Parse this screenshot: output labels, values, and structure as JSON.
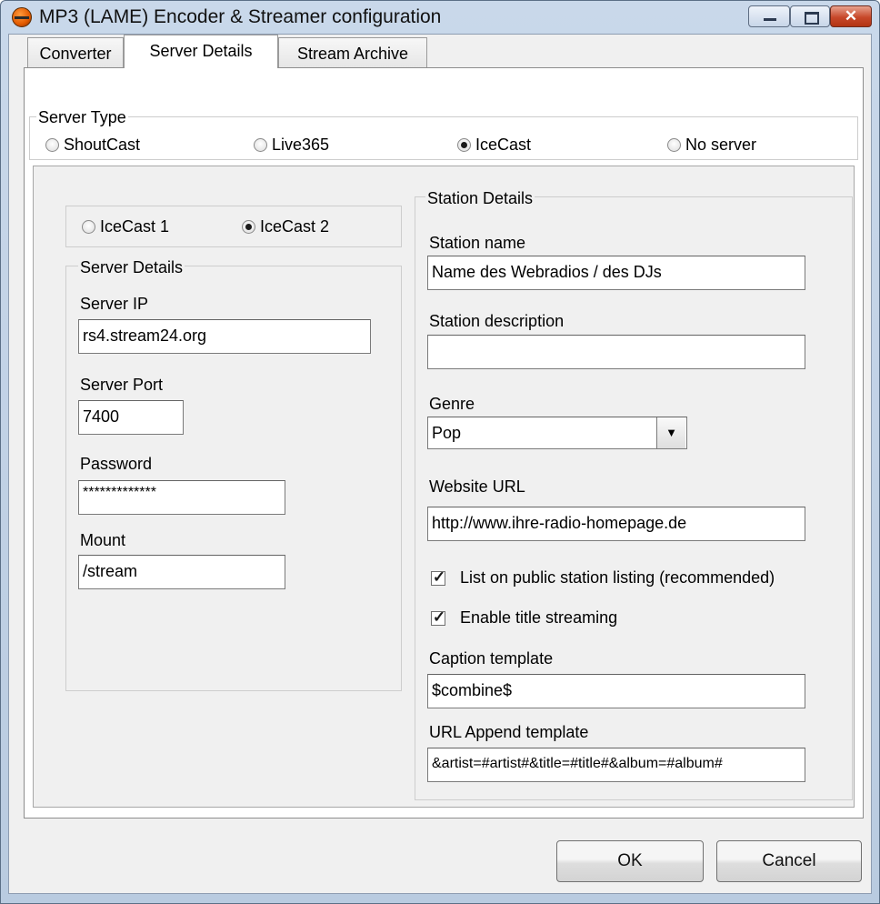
{
  "window": {
    "title": "MP3 (LAME) Encoder & Streamer configuration",
    "close_glyph": "✕"
  },
  "tabs": [
    {
      "label": "Converter",
      "selected": false
    },
    {
      "label": "Server Details",
      "selected": true
    },
    {
      "label": "Stream Archive",
      "selected": false
    }
  ],
  "server_type": {
    "label": "Server Type",
    "options": [
      {
        "label": "ShoutCast",
        "checked": false
      },
      {
        "label": "Live365",
        "checked": false
      },
      {
        "label": "IceCast",
        "checked": true
      },
      {
        "label": "No server",
        "checked": false
      }
    ]
  },
  "icecast_version": {
    "options": [
      {
        "label": "IceCast 1",
        "checked": false
      },
      {
        "label": "IceCast 2",
        "checked": true
      }
    ]
  },
  "server_details": {
    "label": "Server Details",
    "server_ip_label": "Server IP",
    "server_ip_value": "rs4.stream24.org",
    "server_port_label": "Server Port",
    "server_port_value": "7400",
    "password_label": "Password",
    "password_value": "*************",
    "mount_label": "Mount",
    "mount_value": "/stream"
  },
  "station_details": {
    "label": "Station Details",
    "name_label": "Station name",
    "name_value": "Name des Webradios / des DJs",
    "description_label": "Station description",
    "description_value": "",
    "genre_label": "Genre",
    "genre_value": "Pop",
    "website_label": "Website URL",
    "website_value": "http://www.ihre-radio-homepage.de",
    "list_public_label": "List on public station listing (recommended)",
    "list_public_checked": true,
    "title_streaming_label": "Enable title streaming",
    "title_streaming_checked": true,
    "caption_label": "Caption template",
    "caption_value": "$combine$",
    "url_append_label": "URL Append template",
    "url_append_value": "&artist=#artist#&title=#title#&album=#album#"
  },
  "buttons": {
    "ok": "OK",
    "cancel": "Cancel"
  },
  "glyphs": {
    "check": "✓",
    "dropdown": "▼"
  }
}
